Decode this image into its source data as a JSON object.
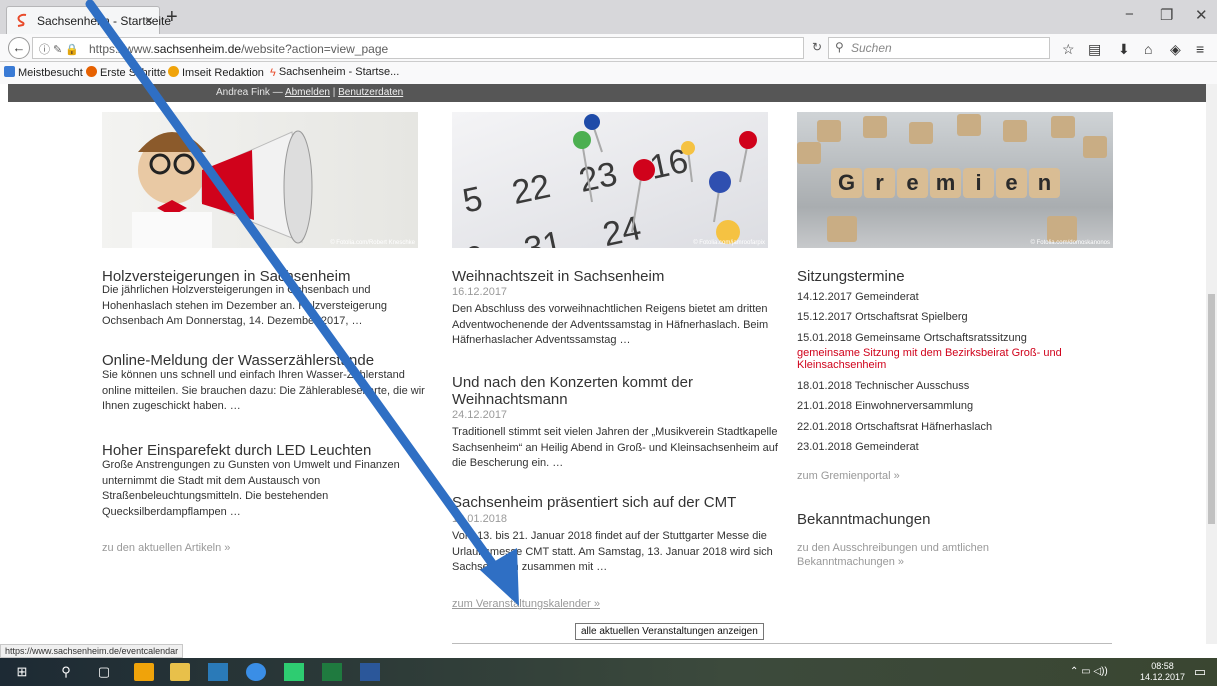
{
  "browser": {
    "tab_title": "Sachsenheim - Startseite",
    "url_prefix": "https://www.",
    "url_host": "sachsenheim.de",
    "url_path": "/website?action=view_page",
    "search_placeholder": "Suchen",
    "bookmarks": [
      {
        "label": "Meistbesucht"
      },
      {
        "label": "Erste Schritte"
      },
      {
        "label": "Imseit Redaktion"
      },
      {
        "label": "Sachsenheim - Startse..."
      }
    ],
    "status_url": "https://www.sachsenheim.de/eventcalendar"
  },
  "userbar": {
    "user": "Andrea Fink —",
    "logout": "Abmelden",
    "sep": "|",
    "userdata": "Benutzerdaten"
  },
  "col1": {
    "image_credit": "© Fotolia.com/Robert Kneschke",
    "articles": [
      {
        "title": "Holzversteigerungen in Sachsenheim",
        "text": "Die jährlichen Holzversteigerungen in Ochsenbach und Hohenhaslach stehen im Dezember an. Holzversteigerung Ochsenbach Am Donnerstag, 14. Dezember 2017, …"
      },
      {
        "title": "Online-Meldung der Wasserzählerstände",
        "text": "Sie können uns schnell und einfach Ihren Wasser-Zählerstand online mitteilen. Sie brauchen dazu: Die Zählerablesekarte, die wir Ihnen zugeschickt haben. …"
      },
      {
        "title": "Hoher Einsparefekt durch LED Leuchten",
        "text": "Große Anstrengungen zu Gunsten von Umwelt und Finanzen unternimmt die Stadt mit dem Austausch von Straßenbeleuchtungsmitteln. Die bestehenden Quecksilberdampflampen …"
      }
    ],
    "more": "zu den aktuellen Artikeln »"
  },
  "col2": {
    "image_credit": "© Fotolia.com/jamroofarpix",
    "articles": [
      {
        "title": "Weihnachtszeit in Sachsenheim",
        "date": "16.12.2017",
        "text": "Den Abschluss des vorweihnachtlichen Reigens bietet am dritten Adventwochenende der Adventssamstag in Häfnerhaslach. Beim Häfnerhaslacher Adventssamstag …"
      },
      {
        "title": "Und nach den Konzerten kommt der",
        "title2": "Weihnachtsmann",
        "date": "24.12.2017",
        "text": "Traditionell stimmt seit vielen Jahren der „Musikverein Stadtkapelle Sachsenheim“ an Heilig Abend in Groß- und Kleinsachsenheim auf die Bescherung ein. …"
      },
      {
        "title": "Sachsenheim präsentiert sich auf der CMT",
        "date": "13.01.2018",
        "text": "Vom 13. bis 21. Januar 2018 findet auf der Stuttgarter Messe die Urlaubsmesse CMT statt. Am Samstag, 13. Januar 2018 wird sich Sachsenheim zusammen mit …"
      }
    ],
    "more": "zum Veranstaltungskalender »",
    "tooltip": "alle aktuellen Veranstaltungen anzeigen"
  },
  "col3": {
    "image_credit": "© Fotolia.com/domoskanonos",
    "image_word": [
      "G",
      "r",
      "e",
      "m",
      "i",
      "e",
      "n"
    ],
    "title": "Sitzungstermine",
    "events": [
      "14.12.2017 Gemeinderat",
      "15.12.2017 Ortschaftsrat Spielberg",
      "15.01.2018 Gemeinsame Ortschaftsratssitzung"
    ],
    "event_note": "gemeinsame Sitzung mit dem Bezirksbeirat Groß- und Kleinsachsenheim",
    "events2": [
      "18.01.2018 Technischer Ausschuss",
      "21.01.2018 Einwohnerversammlung",
      "22.01.2018 Ortschaftsrat Häfnerhaslach",
      "23.01.2018 Gemeinderat"
    ],
    "portal": "zum Gremienportal »",
    "title2": "Bekanntmachungen",
    "ann": "zu den Ausschreibungen und amtlichen Bekanntmachungen »"
  },
  "taskbar": {
    "time": "08:58",
    "date": "14.12.2017"
  },
  "colors": {
    "accent_red": "#d0021b",
    "arrow_blue": "#2f6fc4",
    "userbar": "#565656"
  }
}
